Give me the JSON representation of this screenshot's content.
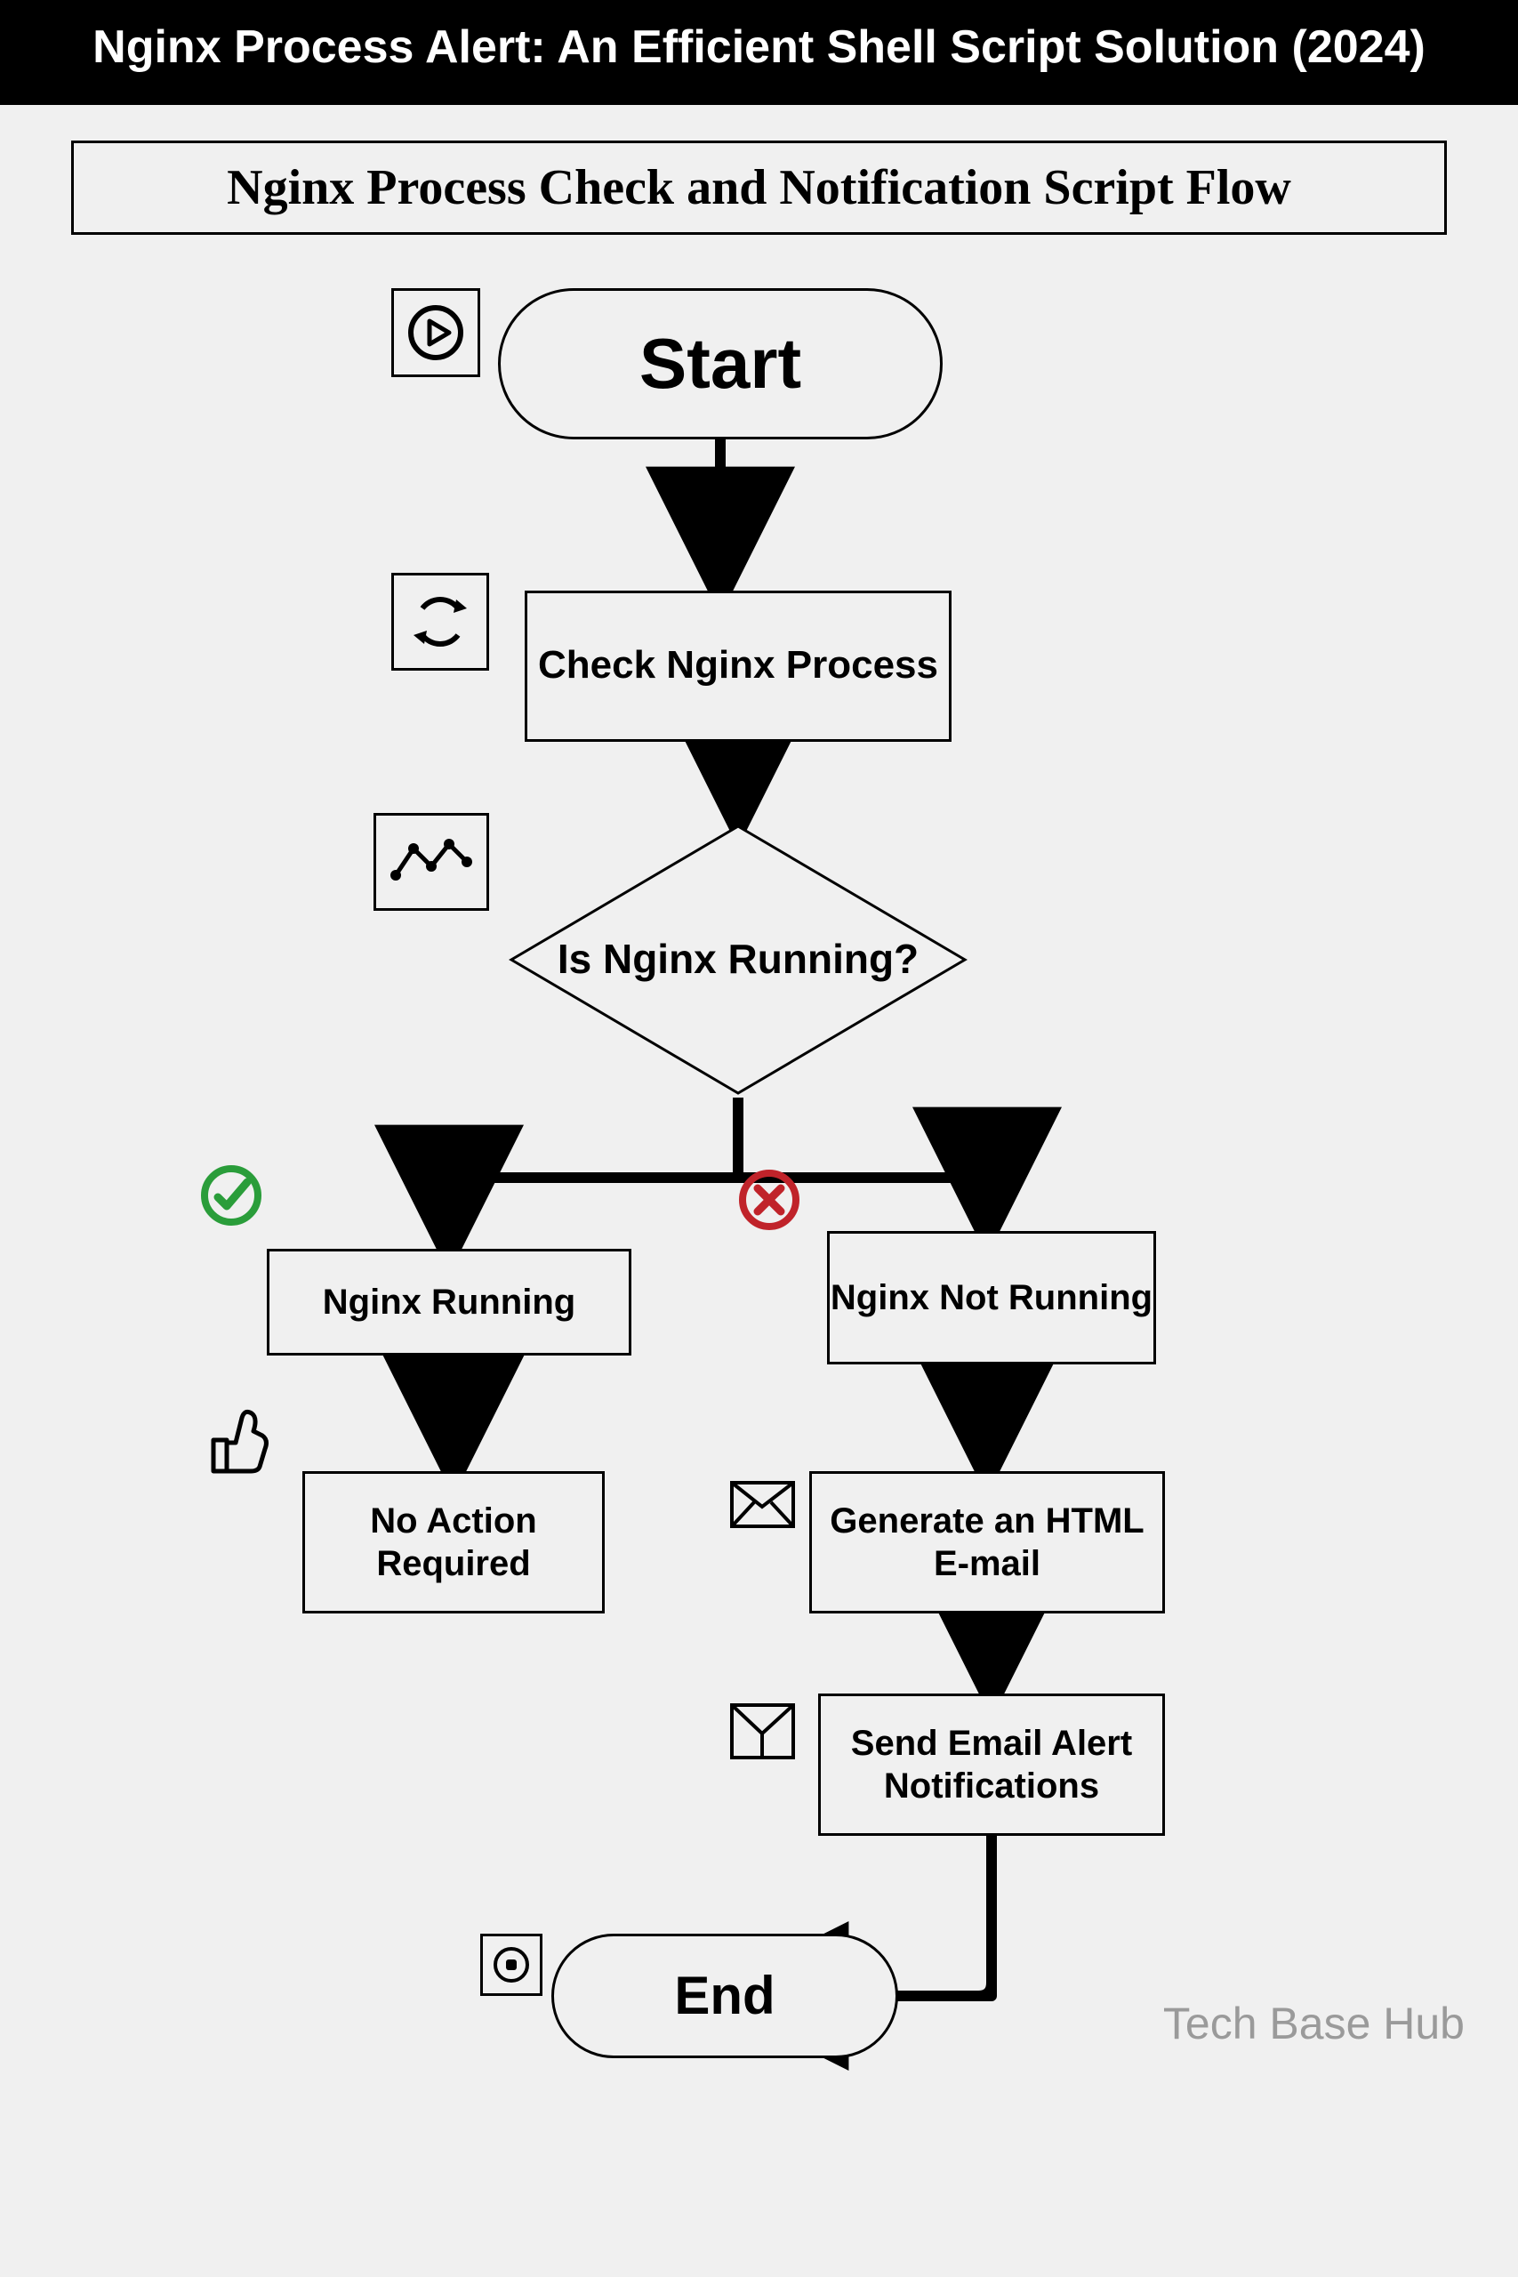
{
  "banner": {
    "title": "Nginx Process Alert: An Efficient Shell Script Solution (2024)"
  },
  "subtitle": "Nginx Process Check and Notification Script Flow",
  "nodes": {
    "start": "Start",
    "check": "Check Nginx Process",
    "decision": "Is Nginx Running?",
    "running": "Nginx Running",
    "notrunning": "Nginx Not Running",
    "noaction": "No Action Required",
    "generate": "Generate an HTML E-mail",
    "send": "Send Email Alert Notifications",
    "end": "End"
  },
  "icons": {
    "play": "play-icon",
    "cycle": "cycle-icon",
    "graph": "graph-icon",
    "check": "check-icon",
    "cross": "cross-icon",
    "thumb": "thumbs-up-icon",
    "mail": "mail-icon",
    "filter": "filter-icon",
    "stop": "stop-icon"
  },
  "brand": "Tech  Base Hub",
  "chart_data": {
    "type": "flowchart",
    "title": "Nginx Process Check and Notification Script Flow",
    "nodes": [
      {
        "id": "start",
        "type": "terminal",
        "label": "Start"
      },
      {
        "id": "check",
        "type": "process",
        "label": "Check Nginx Process"
      },
      {
        "id": "decision",
        "type": "decision",
        "label": "Is Nginx Running?"
      },
      {
        "id": "running",
        "type": "process",
        "label": "Nginx Running"
      },
      {
        "id": "notrunning",
        "type": "process",
        "label": "Nginx Not Running"
      },
      {
        "id": "noaction",
        "type": "process",
        "label": "No Action Required"
      },
      {
        "id": "generate",
        "type": "process",
        "label": "Generate an HTML E-mail"
      },
      {
        "id": "send",
        "type": "process",
        "label": "Send Email Alert Notifications"
      },
      {
        "id": "end",
        "type": "terminal",
        "label": "End"
      }
    ],
    "edges": [
      {
        "from": "start",
        "to": "check"
      },
      {
        "from": "check",
        "to": "decision"
      },
      {
        "from": "decision",
        "to": "running",
        "label": "yes"
      },
      {
        "from": "decision",
        "to": "notrunning",
        "label": "no"
      },
      {
        "from": "running",
        "to": "noaction"
      },
      {
        "from": "notrunning",
        "to": "generate"
      },
      {
        "from": "generate",
        "to": "send"
      },
      {
        "from": "send",
        "to": "end"
      }
    ]
  }
}
